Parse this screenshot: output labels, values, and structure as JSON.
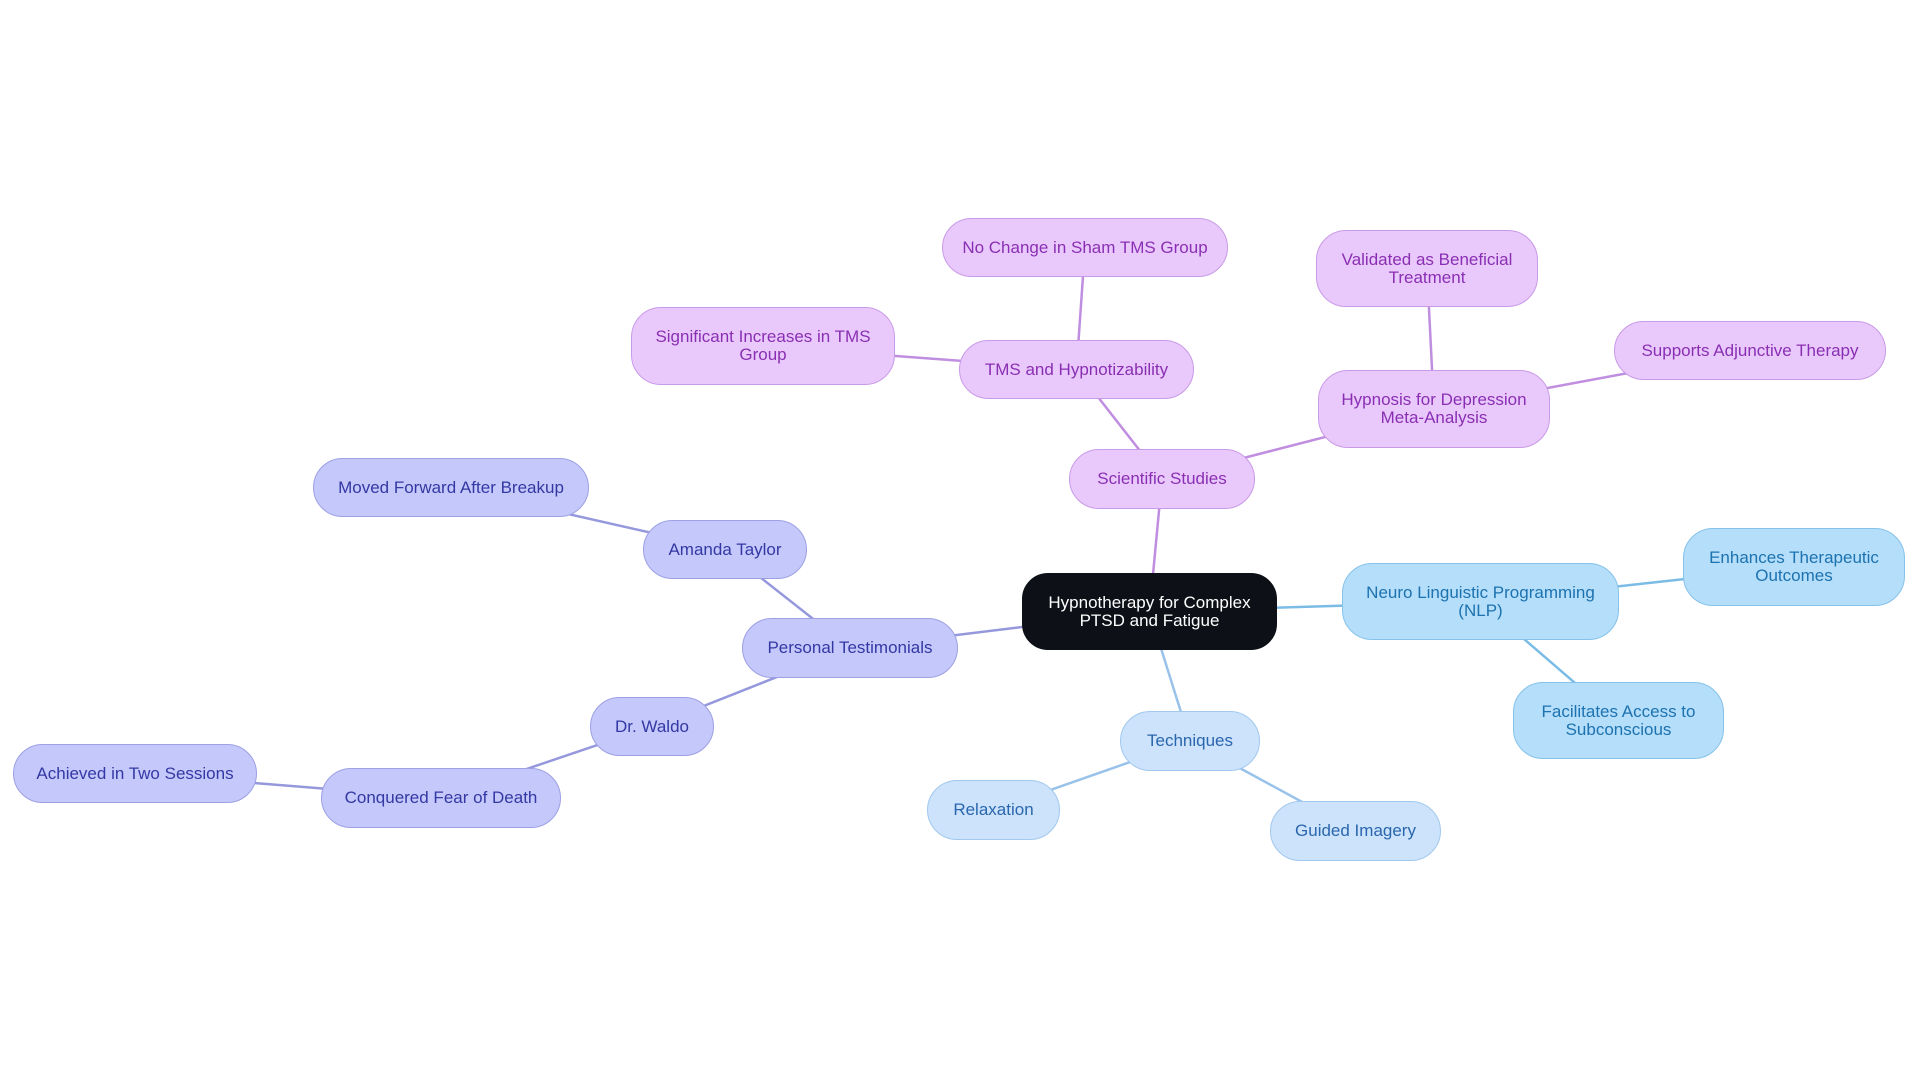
{
  "diagram": {
    "type": "mindmap",
    "root": {
      "id": "root",
      "label": "Hypnotherapy for Complex PTSD and Fatigue"
    },
    "nodes": [
      {
        "id": "sci",
        "label": "Scientific Studies",
        "parent": "root",
        "color": "purple"
      },
      {
        "id": "tms",
        "label": "TMS and Hypnotizability",
        "parent": "sci",
        "color": "purple"
      },
      {
        "id": "nochange",
        "label": "No Change in Sham TMS Group",
        "parent": "tms",
        "color": "purple"
      },
      {
        "id": "sigincr",
        "label": "Significant Increases in TMS Group",
        "parent": "tms",
        "color": "purple"
      },
      {
        "id": "hypdep",
        "label": "Hypnosis for Depression Meta-Analysis",
        "parent": "sci",
        "color": "purple"
      },
      {
        "id": "valid",
        "label": "Validated as Beneficial Treatment",
        "parent": "hypdep",
        "color": "purple"
      },
      {
        "id": "supports",
        "label": "Supports Adjunctive Therapy",
        "parent": "hypdep",
        "color": "purple"
      },
      {
        "id": "nlp",
        "label": "Neuro Linguistic Programming (NLP)",
        "parent": "root",
        "color": "blue"
      },
      {
        "id": "enh",
        "label": "Enhances Therapeutic Outcomes",
        "parent": "nlp",
        "color": "blue"
      },
      {
        "id": "fac",
        "label": "Facilitates Access to Subconscious",
        "parent": "nlp",
        "color": "blue"
      },
      {
        "id": "tech",
        "label": "Techniques",
        "parent": "root",
        "color": "lightblue"
      },
      {
        "id": "relax",
        "label": "Relaxation",
        "parent": "tech",
        "color": "lightblue"
      },
      {
        "id": "guided",
        "label": "Guided Imagery",
        "parent": "tech",
        "color": "lightblue"
      },
      {
        "id": "pers",
        "label": "Personal Testimonials",
        "parent": "root",
        "color": "indigo"
      },
      {
        "id": "amanda",
        "label": "Amanda Taylor",
        "parent": "pers",
        "color": "indigo"
      },
      {
        "id": "moved",
        "label": "Moved Forward After Breakup",
        "parent": "amanda",
        "color": "indigo"
      },
      {
        "id": "waldo",
        "label": "Dr. Waldo",
        "parent": "pers",
        "color": "indigo"
      },
      {
        "id": "conq",
        "label": "Conquered Fear of Death",
        "parent": "waldo",
        "color": "indigo"
      },
      {
        "id": "achieved",
        "label": "Achieved in Two Sessions",
        "parent": "conq",
        "color": "indigo"
      }
    ],
    "colors": {
      "root": "#0d1117",
      "purple": "#e9c9fb",
      "blue": "#b4def9",
      "lightblue": "#cce3fb",
      "indigo": "#c5c8fb"
    }
  }
}
